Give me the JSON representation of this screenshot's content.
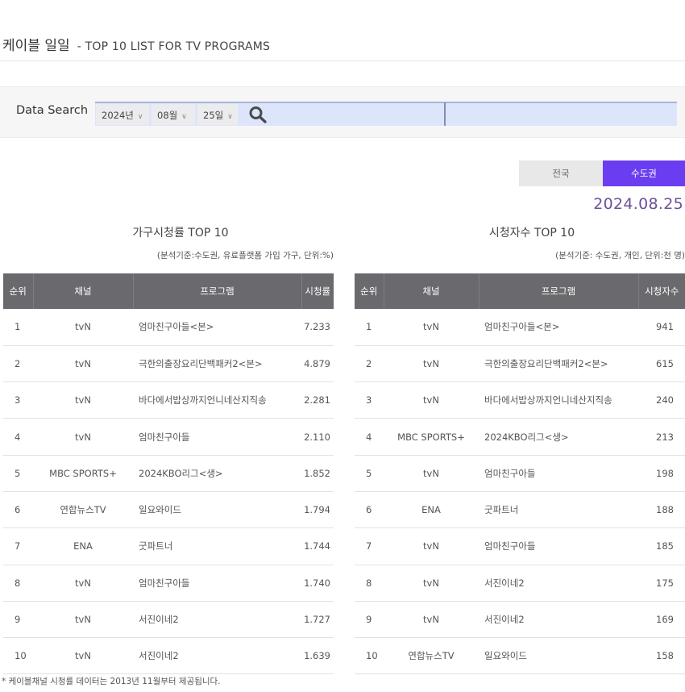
{
  "header": {
    "title": "케이블 일일",
    "subtitle": "- TOP 10 LIST FOR TV PROGRAMS"
  },
  "search": {
    "label": "Data Search",
    "year": "2024년",
    "month": "08월",
    "day": "25일",
    "chevron": "∨",
    "search_icon": "search-icon"
  },
  "region_tabs": [
    {
      "label": "전국",
      "active": false
    },
    {
      "label": "수도권",
      "active": true
    }
  ],
  "colors": {
    "accent": "#6a3ef0",
    "value_text": "#7a4fa8",
    "table_header_bg": "#6a6a6e",
    "search_field_bg": "#dde5fb"
  },
  "date": "2024.08.25",
  "household": {
    "title": "가구시청률 TOP 10",
    "note": "(분석기준:수도권, 유료플랫폼 가입 가구, 단위:%)",
    "columns": [
      "순위",
      "채널",
      "프로그램",
      "시청률"
    ],
    "rows": [
      {
        "rank": "1",
        "channel": "tvN",
        "program": "엄마친구아들<본>",
        "value": "7.233"
      },
      {
        "rank": "2",
        "channel": "tvN",
        "program": "극한의출장요리단백패커2<본>",
        "value": "4.879"
      },
      {
        "rank": "3",
        "channel": "tvN",
        "program": "바다에서밥상까지언니네산지직송",
        "value": "2.281"
      },
      {
        "rank": "4",
        "channel": "tvN",
        "program": "엄마친구아들",
        "value": "2.110"
      },
      {
        "rank": "5",
        "channel": "MBC SPORTS+",
        "program": "2024KBO리그<생>",
        "value": "1.852"
      },
      {
        "rank": "6",
        "channel": "연합뉴스TV",
        "program": "일요와이드",
        "value": "1.794"
      },
      {
        "rank": "7",
        "channel": "ENA",
        "program": "굿파트너",
        "value": "1.744"
      },
      {
        "rank": "8",
        "channel": "tvN",
        "program": "엄마친구아들",
        "value": "1.740"
      },
      {
        "rank": "9",
        "channel": "tvN",
        "program": "서진이네2",
        "value": "1.727"
      },
      {
        "rank": "10",
        "channel": "tvN",
        "program": "서진이네2",
        "value": "1.639"
      }
    ]
  },
  "viewers": {
    "title": "시청자수 TOP 10",
    "note": "(분석기준: 수도권, 개인, 단위:천 명)",
    "columns": [
      "순위",
      "채널",
      "프로그램",
      "시청자수"
    ],
    "rows": [
      {
        "rank": "1",
        "channel": "tvN",
        "program": "엄마친구아들<본>",
        "value": "941"
      },
      {
        "rank": "2",
        "channel": "tvN",
        "program": "극한의출장요리단백패커2<본>",
        "value": "615"
      },
      {
        "rank": "3",
        "channel": "tvN",
        "program": "바다에서밥상까지언니네산지직송",
        "value": "240"
      },
      {
        "rank": "4",
        "channel": "MBC SPORTS+",
        "program": "2024KBO리그<생>",
        "value": "213"
      },
      {
        "rank": "5",
        "channel": "tvN",
        "program": "엄마친구아들",
        "value": "198"
      },
      {
        "rank": "6",
        "channel": "ENA",
        "program": "굿파트너",
        "value": "188"
      },
      {
        "rank": "7",
        "channel": "tvN",
        "program": "엄마친구아들",
        "value": "185"
      },
      {
        "rank": "8",
        "channel": "tvN",
        "program": "서진이네2",
        "value": "175"
      },
      {
        "rank": "9",
        "channel": "tvN",
        "program": "서진이네2",
        "value": "169"
      },
      {
        "rank": "10",
        "channel": "연합뉴스TV",
        "program": "일요와이드",
        "value": "158"
      }
    ]
  },
  "footnote": "* 케이블채널 시청률 데이터는 2013년 11월부터 제공됩니다."
}
